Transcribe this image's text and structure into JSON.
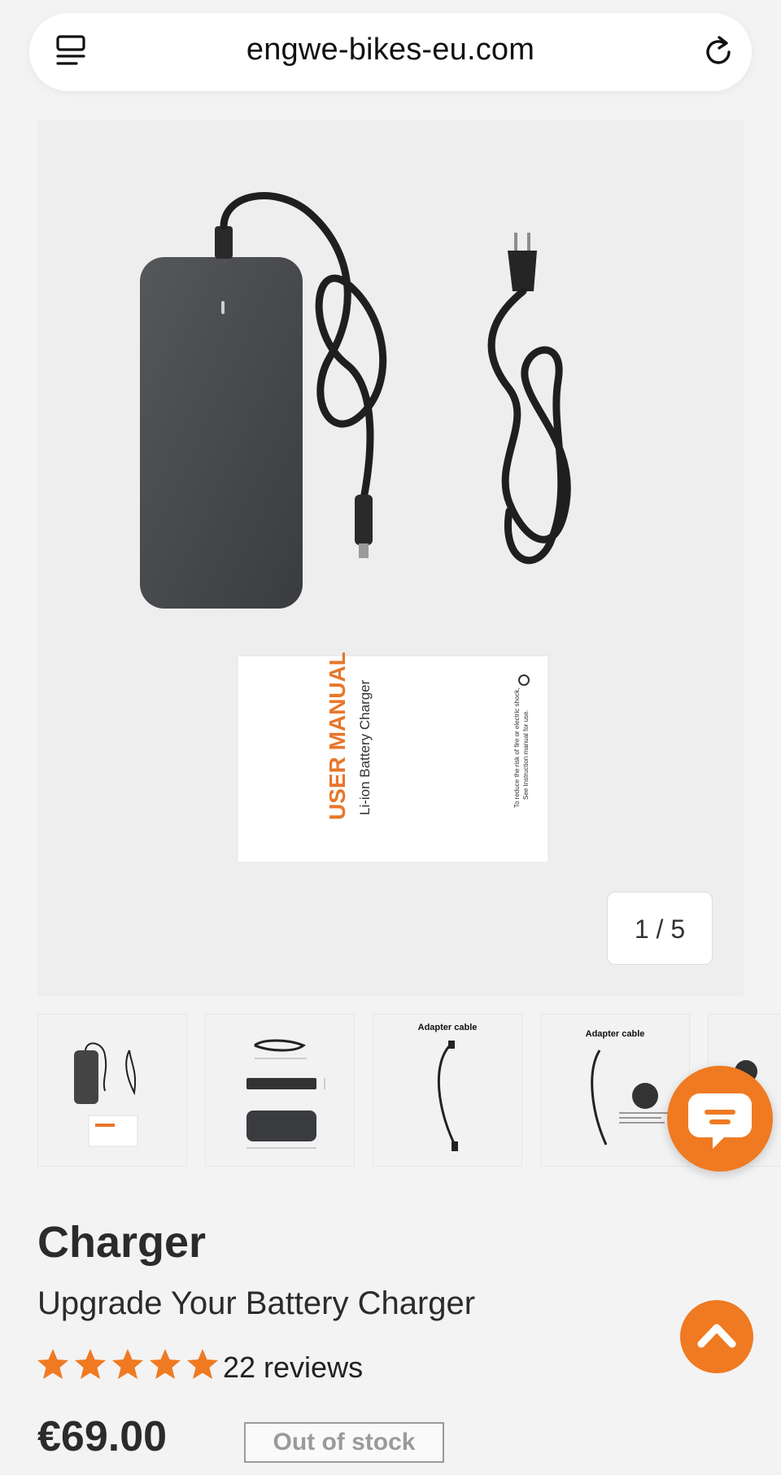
{
  "browser": {
    "url": "engwe-bikes-eu.com",
    "menu_icon": "tab-list-icon",
    "reload_icon": "reload-icon"
  },
  "gallery": {
    "counter": "1 / 5",
    "main_image_icon": "charger-product-photo",
    "manual_title": "USER MANUAL",
    "manual_subtitle": "Li-ion Battery Charger",
    "manual_note_1": "To reduce the risk of fire or electric shock,",
    "manual_note_2": "See Instruction manual for use.",
    "thumbnails": [
      {
        "caption": ""
      },
      {
        "caption": ""
      },
      {
        "caption": "Adapter cable"
      },
      {
        "caption": "Adapter cable"
      },
      {
        "caption": ""
      }
    ]
  },
  "chat": {
    "icon": "chat-bubble-icon",
    "color": "#ef7a22"
  },
  "product": {
    "title": "Charger",
    "subtitle": "Upgrade Your Battery Charger",
    "rating": 5,
    "reviews": "22 reviews",
    "price": "€69.00",
    "stock": "Out of stock"
  },
  "scroll_top": {
    "icon": "chevron-up-icon"
  },
  "colors": {
    "accent": "#ef7a22",
    "star": "#ef7a22",
    "text": "#2b2b2b"
  }
}
